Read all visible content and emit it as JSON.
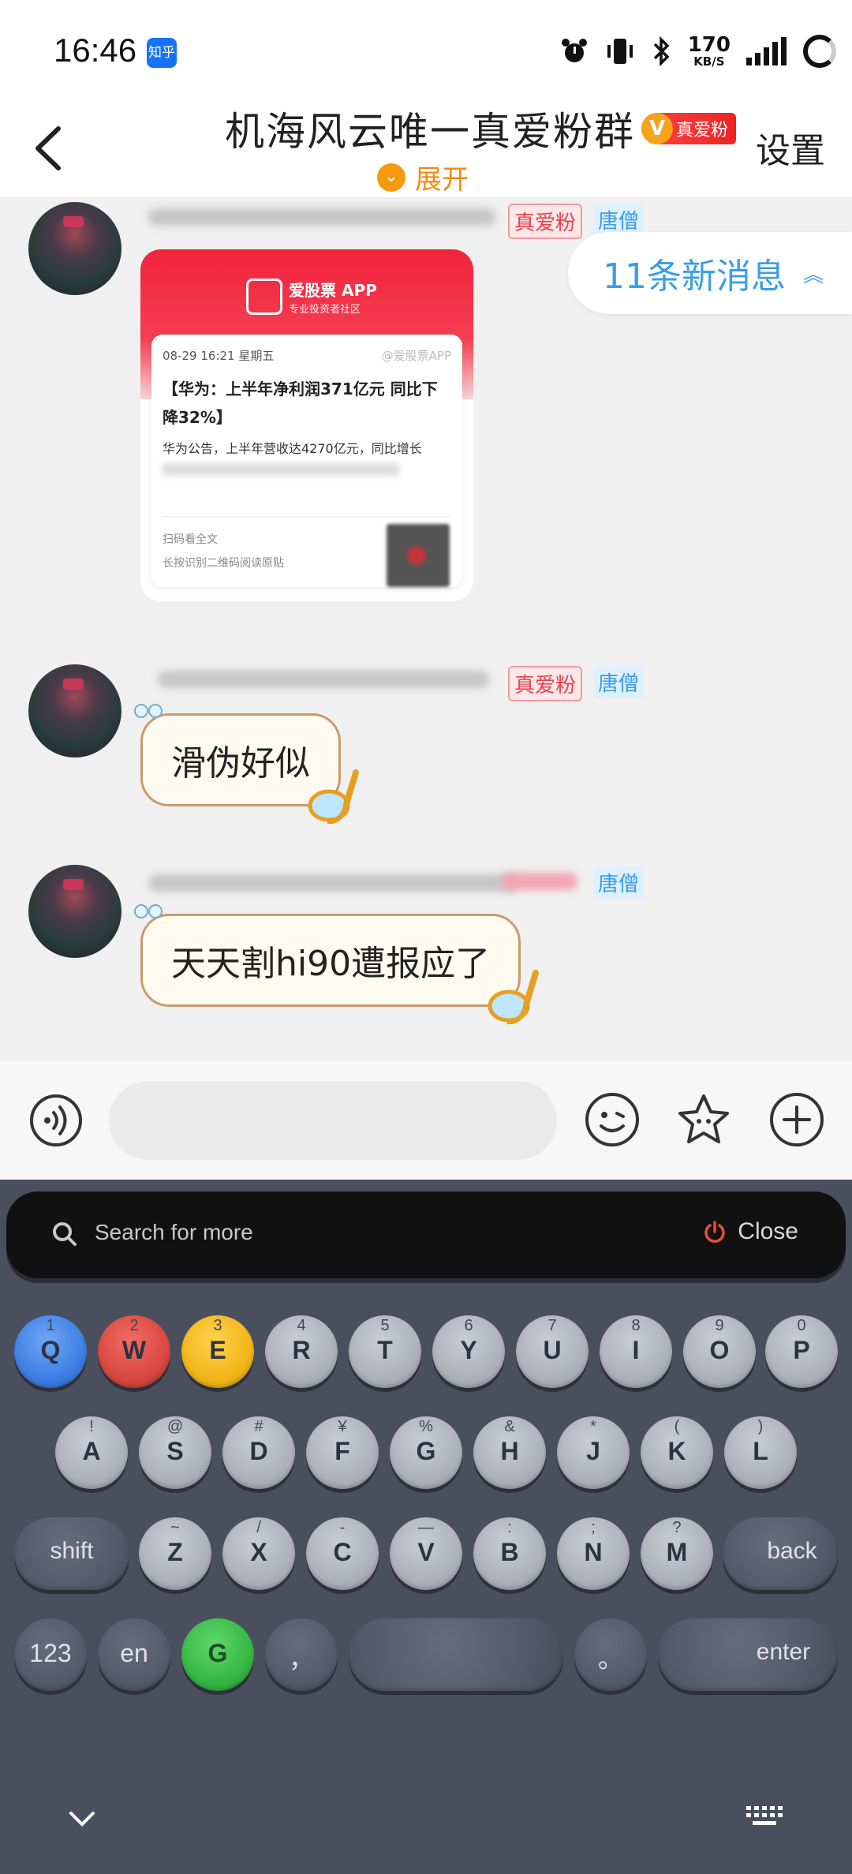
{
  "status": {
    "time": "16:46",
    "app_badge": "知乎",
    "net_speed_value": "170",
    "net_speed_unit": "KB/S"
  },
  "header": {
    "title": "机海风云唯一真爱粉群",
    "fan_tag": "真爱粉",
    "fan_tag_v": "V",
    "expand_label": "展开",
    "settings_label": "设置"
  },
  "chat": {
    "new_messages_label": "11条新消息",
    "messages": [
      {
        "tag_fan": "真爱粉",
        "tag_title": "唐僧",
        "type": "card",
        "card": {
          "app_name": "爱股票 APP",
          "app_slogan": "专业投资者社区",
          "date": "08-29 16:21 星期五",
          "source": "@爱股票APP",
          "headline": "【华为：上半年净利润371亿元 同比下降32%】",
          "body": "华为公告，上半年营收达4270亿元，同比增长",
          "footer_line1": "扫码看全文",
          "footer_line2": "长按识别二维码阅读原贴"
        }
      },
      {
        "tag_fan": "真爱粉",
        "tag_title": "唐僧",
        "type": "text",
        "text": "滑伪好似"
      },
      {
        "tag_title": "唐僧",
        "type": "text",
        "text": "天天割hi90遭报应了"
      }
    ]
  },
  "input": {
    "placeholder": ""
  },
  "keyboard": {
    "search_placeholder": "Search for more",
    "close_label": "Close",
    "row1": [
      {
        "main": "Q",
        "sub": "1"
      },
      {
        "main": "W",
        "sub": "2"
      },
      {
        "main": "E",
        "sub": "3"
      },
      {
        "main": "R",
        "sub": "4"
      },
      {
        "main": "T",
        "sub": "5"
      },
      {
        "main": "Y",
        "sub": "6"
      },
      {
        "main": "U",
        "sub": "7"
      },
      {
        "main": "I",
        "sub": "8"
      },
      {
        "main": "O",
        "sub": "9"
      },
      {
        "main": "P",
        "sub": "0"
      }
    ],
    "row2": [
      {
        "main": "A",
        "sub": "!"
      },
      {
        "main": "S",
        "sub": "@"
      },
      {
        "main": "D",
        "sub": "#"
      },
      {
        "main": "F",
        "sub": "¥"
      },
      {
        "main": "G",
        "sub": "%"
      },
      {
        "main": "H",
        "sub": "&"
      },
      {
        "main": "J",
        "sub": "*"
      },
      {
        "main": "K",
        "sub": "("
      },
      {
        "main": "L",
        "sub": ")"
      }
    ],
    "row3": [
      {
        "main": "Z",
        "sub": "~"
      },
      {
        "main": "X",
        "sub": "/"
      },
      {
        "main": "C",
        "sub": "-"
      },
      {
        "main": "V",
        "sub": "—"
      },
      {
        "main": "B",
        "sub": ":"
      },
      {
        "main": "N",
        "sub": ";"
      },
      {
        "main": "M",
        "sub": "?"
      }
    ],
    "shift_label": "shift",
    "back_label": "back",
    "num_label": "123",
    "lang_label": "en",
    "g_label": "G",
    "comma_label": "，",
    "period_label": "。",
    "enter_label": "enter"
  }
}
